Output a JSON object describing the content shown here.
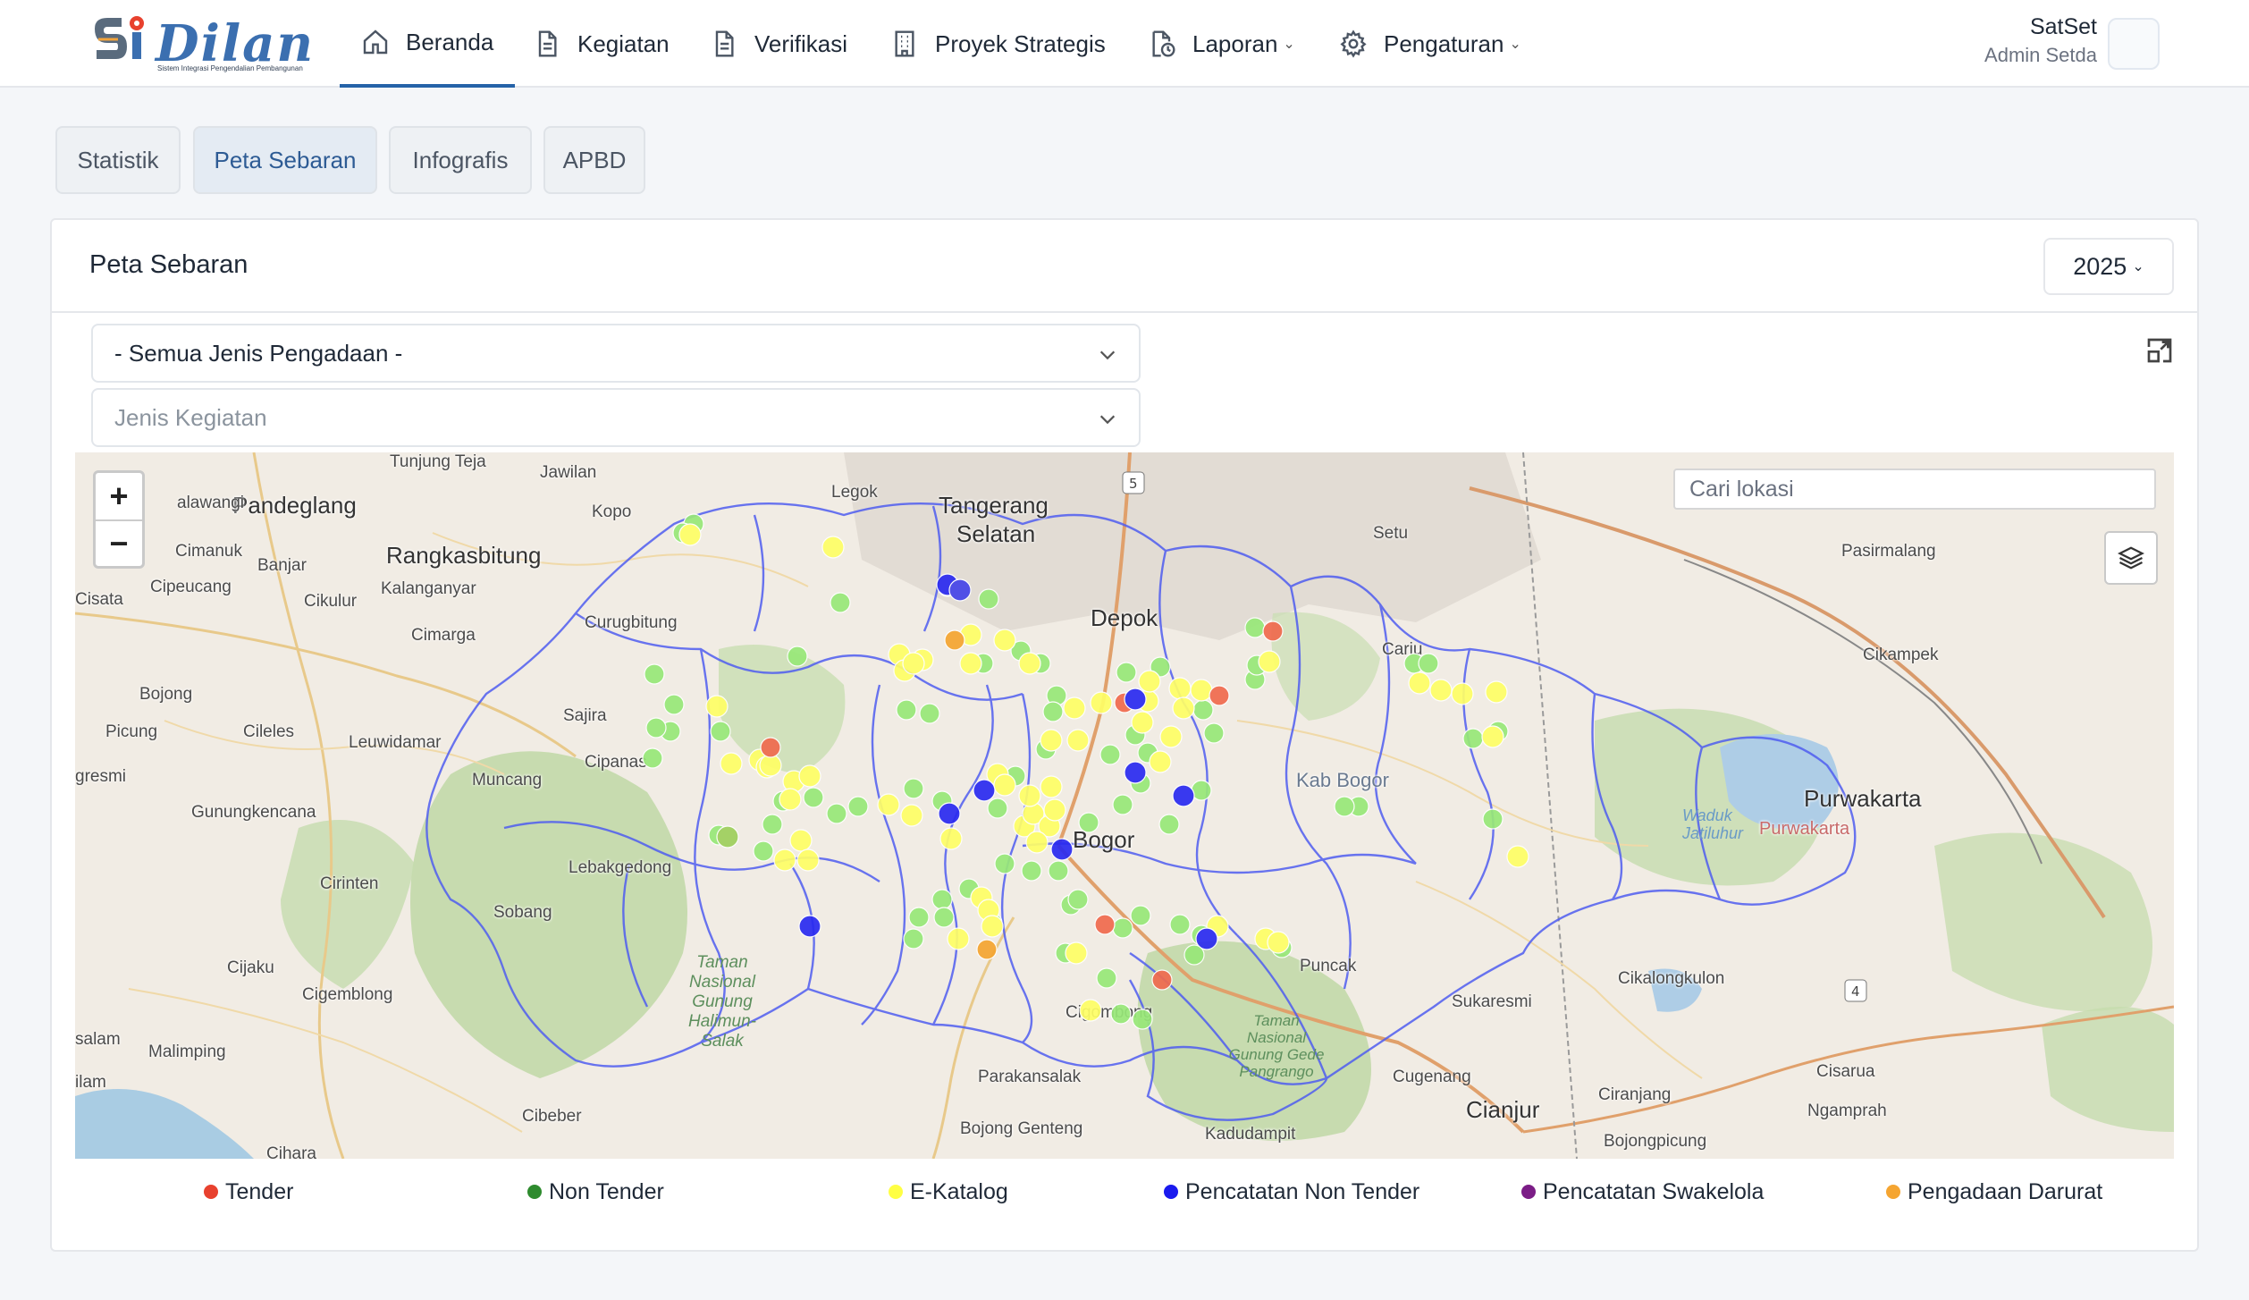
{
  "app": {
    "logo_text": "Dilan",
    "logo_subtitle": "Sistem Integrasi Pengendalian Pembangunan"
  },
  "nav": {
    "items": [
      {
        "label": "Beranda",
        "icon": "home-icon"
      },
      {
        "label": "Kegiatan",
        "icon": "document-icon"
      },
      {
        "label": "Verifikasi",
        "icon": "document-icon"
      },
      {
        "label": "Proyek Strategis",
        "icon": "building-icon"
      },
      {
        "label": "Laporan",
        "icon": "report-icon",
        "dropdown": true
      },
      {
        "label": "Pengaturan",
        "icon": "gear-icon",
        "dropdown": true
      }
    ],
    "active": "Beranda"
  },
  "user": {
    "name": "SatSet",
    "role": "Admin Setda"
  },
  "tabs": {
    "items": [
      "Statistik",
      "Peta Sebaran",
      "Infografis",
      "APBD"
    ],
    "active": "Peta Sebaran"
  },
  "card": {
    "title": "Peta Sebaran",
    "year": "2025"
  },
  "filters": {
    "procurement_type": "- Semua Jenis Pengadaan -",
    "activity_type_placeholder": "Jenis Kegiatan"
  },
  "map": {
    "search_placeholder": "Cari lokasi",
    "zoom_in": "+",
    "zoom_out": "−",
    "places": {
      "tunjung_teja": "Tunjung Teja",
      "jawilan": "Jawilan",
      "legok": "Legok",
      "tangerang_selatan_1": "Tangerang",
      "tangerang_selatan_2": "Selatan",
      "pandeglang": "Pandeglang",
      "kopo": "Kopo",
      "alawangi": "alawangi",
      "cimanuk": "Cimanuk",
      "banjar": "Banjar",
      "rangkasbitung": "Rangkasbitung",
      "cipeucang": "Cipeucang",
      "kalanganyar": "Kalanganyar",
      "cisata": "Cisata",
      "cikulur": "Cikulur",
      "cimarga": "Cimarga",
      "curugbitung": "Curugbitung",
      "depok": "Depok",
      "setu": "Setu",
      "pasirmalang": "Pasirmalang",
      "cikampek": "Cikampek",
      "bojong": "Bojong",
      "picung": "Picung",
      "cileles": "Cileles",
      "leuwidamar": "Leuwidamar",
      "sajira": "Sajira",
      "cipanas": "Cipanas",
      "muncang": "Muncang",
      "gresmi": "gresmi",
      "gunungkencana": "Gunungkencana",
      "lebakgedong": "Lebakgedong",
      "cirinten": "Cirinten",
      "sobang": "Sobang",
      "cijaku": "Cijaku",
      "cigemblong": "Cigemblong",
      "salam": "salam",
      "malimping": "Malimping",
      "ilam": "ilam",
      "cibeber": "Cibeber",
      "cihara": "Cihara",
      "bogor": "Bogor",
      "kab_bogor": "Kab Bogor",
      "purwakarta": "Purwakarta",
      "purwakarta2": "Purwakarta",
      "puncak": "Puncak",
      "sukaresmi": "Sukaresmi",
      "cikalongkulon": "Cikalongkulon",
      "cugenang": "Cugenang",
      "cianjur": "Cianjur",
      "ciranjang": "Ciranjang",
      "cisarua": "Cisarua",
      "ngamprah": "Ngamprah",
      "bojongpicung": "Bojongpicung",
      "parakansalak": "Parakansalak",
      "bojong_genteng": "Bojong Genteng",
      "kadudampit": "Kadudampit",
      "cigombong": "Cigombong",
      "cariu": "Cariu",
      "taman_nasional_halimun": "Taman Nasional Gunung Halimun-Salak",
      "taman_nasional_gede": "Taman Nasional Gunung Gede Pangrango",
      "waduk_jatiluhur": "Waduk Jatiluhur"
    }
  },
  "legend": [
    {
      "label": "Tender",
      "color": "#e8412e"
    },
    {
      "label": "Non Tender",
      "color": "#2e8b2e"
    },
    {
      "label": "E-Katalog",
      "color": "#ffff44"
    },
    {
      "label": "Pencatatan Non Tender",
      "color": "#1a1aee"
    },
    {
      "label": "Pencatatan Swakelola",
      "color": "#7b1d86"
    },
    {
      "label": "Pengadaan Darurat",
      "color": "#f5a531"
    }
  ]
}
